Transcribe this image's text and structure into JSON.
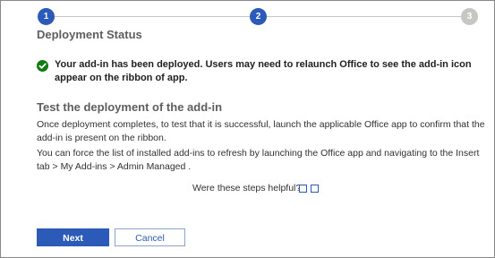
{
  "stepper": {
    "steps": [
      {
        "number": "1",
        "state": "completed"
      },
      {
        "number": "2",
        "state": "current"
      },
      {
        "number": "3",
        "state": "upcoming"
      }
    ]
  },
  "status": {
    "title": "Deployment Status",
    "success_icon": "check-circle-icon",
    "message": "Your add-in has been deployed. Users may need to relaunch Office to see the add-in icon appear on the ribbon of app."
  },
  "test": {
    "heading": "Test the deployment of the add-in",
    "paragraph1": "Once deployment completes, to test that it is successful, launch the applicable Office app to confirm that the add-in is present on the ribbon.",
    "paragraph2": "You can force the list of installed add-ins to refresh by launching the Office app and navigating to the Insert tab > My Add-ins > Admin Managed ."
  },
  "feedback": {
    "question": "Were these steps helpful?"
  },
  "buttons": {
    "next": "Next",
    "cancel": "Cancel"
  },
  "colors": {
    "accent": "#2b5ab8",
    "success": "#107c10",
    "inactive_step": "#c8c6c4"
  }
}
